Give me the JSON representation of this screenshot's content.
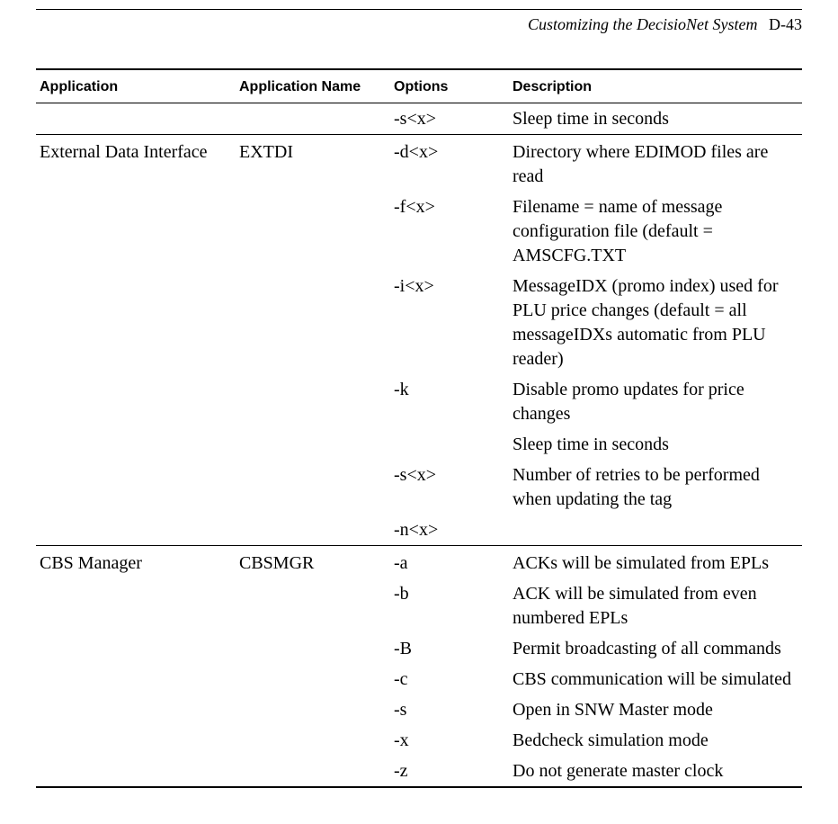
{
  "runningHead": {
    "title": "Customizing the DecisioNet System",
    "page": "D-43"
  },
  "headers": {
    "c1": "Application",
    "c2": "Application Name",
    "c3": "Options",
    "c4": "Description"
  },
  "rows": [
    {
      "app": "",
      "name": "",
      "opt": "-s<x>",
      "desc": "Sleep time in seconds"
    },
    {
      "sep": true,
      "app": "External Data Interface",
      "name": "EXTDI",
      "opt": "-d<x>",
      "desc": "Directory where EDIMOD files are read"
    },
    {
      "app": "",
      "name": "",
      "opt": "-f<x>",
      "desc": "Filename = name of message configuration file (default = AMSCFG.TXT"
    },
    {
      "app": "",
      "name": "",
      "opt": "-i<x>",
      "desc": "MessageIDX (promo index) used for PLU price changes (default = all messageIDXs automatic from PLU reader)"
    },
    {
      "app": "",
      "name": "",
      "opt": "-k",
      "desc": "Disable promo updates for price changes"
    },
    {
      "app": "",
      "name": "",
      "opt": "",
      "desc": "Sleep time in seconds"
    },
    {
      "app": "",
      "name": "",
      "opt": "-s<x>",
      "desc": "Number of retries to be performed when updating the tag"
    },
    {
      "app": "",
      "name": "",
      "opt": "-n<x>",
      "desc": ""
    },
    {
      "sep": true,
      "app": "CBS Manager",
      "name": "CBSMGR",
      "opt": "-a",
      "desc": "ACKs will be simulated from EPLs"
    },
    {
      "app": "",
      "name": "",
      "opt": "-b",
      "desc": "ACK will be simulated from even numbered EPLs"
    },
    {
      "app": "",
      "name": "",
      "opt": "-B",
      "desc": "Permit broadcasting of all commands"
    },
    {
      "app": "",
      "name": "",
      "opt": "-c",
      "desc": "CBS communication will be simulated"
    },
    {
      "app": "",
      "name": "",
      "opt": "-s",
      "desc": "Open in SNW Master mode"
    },
    {
      "app": "",
      "name": "",
      "opt": "-x",
      "desc": "Bedcheck simulation mode"
    },
    {
      "bottom": true,
      "app": "",
      "name": "",
      "opt": "-z",
      "desc": "Do not generate master clock"
    }
  ]
}
